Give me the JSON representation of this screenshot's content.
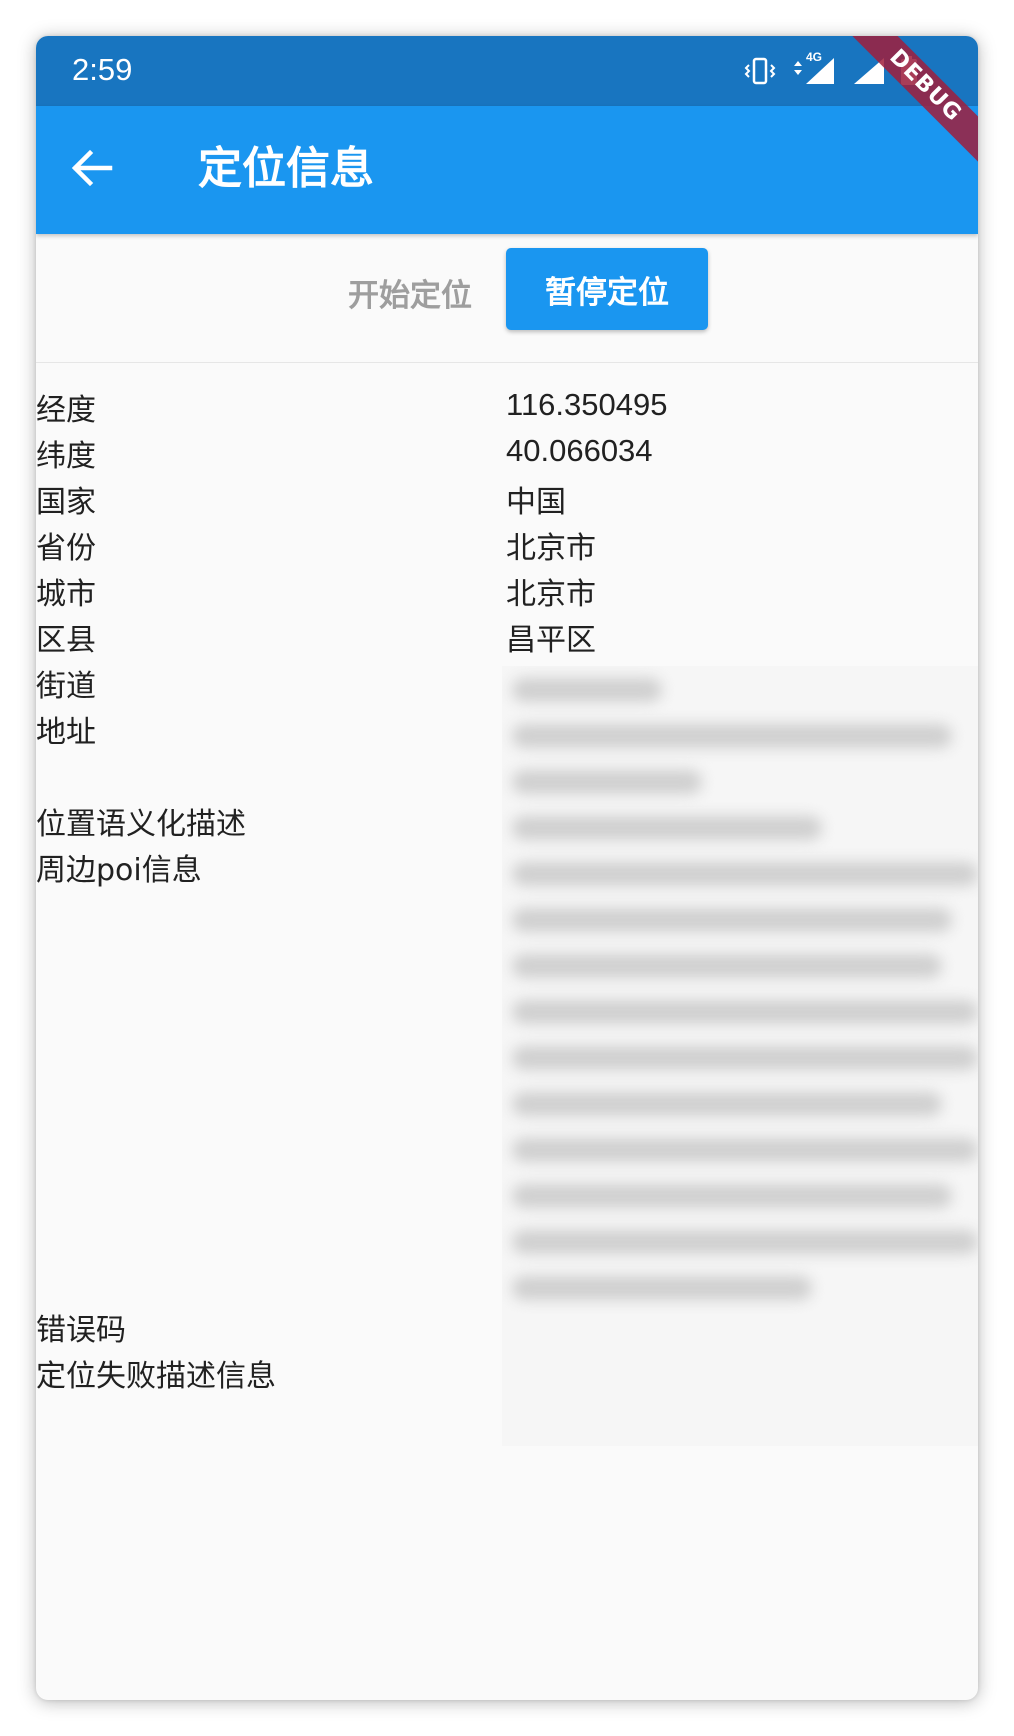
{
  "status_bar": {
    "time": "2:59",
    "network": "4G",
    "debug_banner": "DEBUG"
  },
  "app_bar": {
    "title": "定位信息"
  },
  "actions": {
    "start_label": "开始定位",
    "pause_label": "暂停定位"
  },
  "fields": [
    {
      "label": "经度",
      "value": "116.350495"
    },
    {
      "label": "纬度",
      "value": "40.066034"
    },
    {
      "label": "国家",
      "value": "中国"
    },
    {
      "label": "省份",
      "value": "北京市"
    },
    {
      "label": "城市",
      "value": "北京市"
    },
    {
      "label": "区县",
      "value": "昌平区"
    },
    {
      "label": "街道",
      "value": ""
    },
    {
      "label": "地址",
      "value": ""
    },
    {
      "label": "位置语义化描述",
      "value": ""
    },
    {
      "label": "周边poi信息",
      "value": ""
    },
    {
      "label": "错误码",
      "value": ""
    },
    {
      "label": "定位失败描述信息",
      "value": ""
    }
  ],
  "colors": {
    "status_bar": "#1875c0",
    "app_bar": "#1a96f0",
    "accent": "#1a96f0",
    "debug_ribbon": "#a01e3c"
  },
  "icons": {
    "back": "arrow-back-icon",
    "vibrate": "vibrate-icon",
    "signal": "cell-signal-icon",
    "battery": "battery-icon"
  }
}
